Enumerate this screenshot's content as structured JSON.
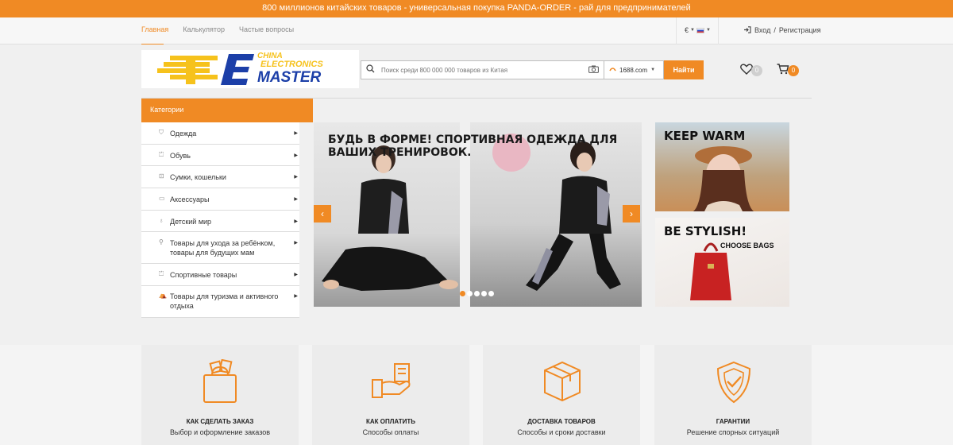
{
  "promo_bar": {
    "text": "800 миллионов китайских товаров - универсальная покупка  PANDA-ORDER - рай для предпринимателей"
  },
  "topnav": {
    "tabs": [
      {
        "label": "Главная",
        "active": true
      },
      {
        "label": "Калькулятор",
        "active": false
      },
      {
        "label": "Частые вопросы",
        "active": false
      }
    ],
    "currency": "€",
    "login": "Вход",
    "divider": "/",
    "register": "Регистрация"
  },
  "logo": {
    "line1": "CHINA",
    "line2": "ELECTRONICS",
    "line3": "MASTER",
    "accent": "#f6c21c",
    "brand": "#1c3fa8"
  },
  "search": {
    "placeholder": "Поиск среди 800 000 000 товаров из Китая",
    "source": "1688.com",
    "button": "Найти"
  },
  "header_icons": {
    "wishlist_count": "0",
    "cart_count": "0"
  },
  "categories": {
    "title": "Категории",
    "items": [
      {
        "label": "Одежда",
        "icon": "shirt-icon"
      },
      {
        "label": "Обувь",
        "icon": "shoe-icon"
      },
      {
        "label": "Сумки, кошельки",
        "icon": "bag-icon"
      },
      {
        "label": "Аксессуары",
        "icon": "wallet-icon"
      },
      {
        "label": "Детский мир",
        "icon": "baby-bottle-icon"
      },
      {
        "label": "Товары для ухода за ребёнком, товары для будущих мам",
        "icon": "stroller-icon"
      },
      {
        "label": "Спортивные товары",
        "icon": "shoe-icon"
      },
      {
        "label": "Товары для туризма и активного отдыха",
        "icon": "tent-icon"
      }
    ]
  },
  "slider": {
    "title": "БУДЬ В ФОРМЕ! СПОРТИВНАЯ ОДЕЖДА ДЛЯ ВАШИХ ТРЕНИРОВОК.",
    "slides": 5,
    "active_slide": 1
  },
  "promo_cards": [
    {
      "title": "KEEP WARM",
      "subtitle": ""
    },
    {
      "title": "BE STYLISH!",
      "subtitle": "CHOOSE BAGS"
    }
  ],
  "features": [
    {
      "title": "КАК СДЕЛАТЬ ЗАКАЗ",
      "subtitle": "Выбор и оформление заказов",
      "icon": "shopping-bag-icon"
    },
    {
      "title": "КАК ОПЛАТИТЬ",
      "subtitle": "Способы оплаты",
      "icon": "payment-hand-icon"
    },
    {
      "title": "ДОСТАВКА ТОВАРОВ",
      "subtitle": "Способы и сроки доставки",
      "icon": "box-icon"
    },
    {
      "title": "ГАРАНТИИ",
      "subtitle": "Решение спорных ситуаций",
      "icon": "shield-check-icon"
    }
  ],
  "colors": {
    "accent": "#f08a24",
    "text": "#333333",
    "background": "#f0f0f0"
  }
}
